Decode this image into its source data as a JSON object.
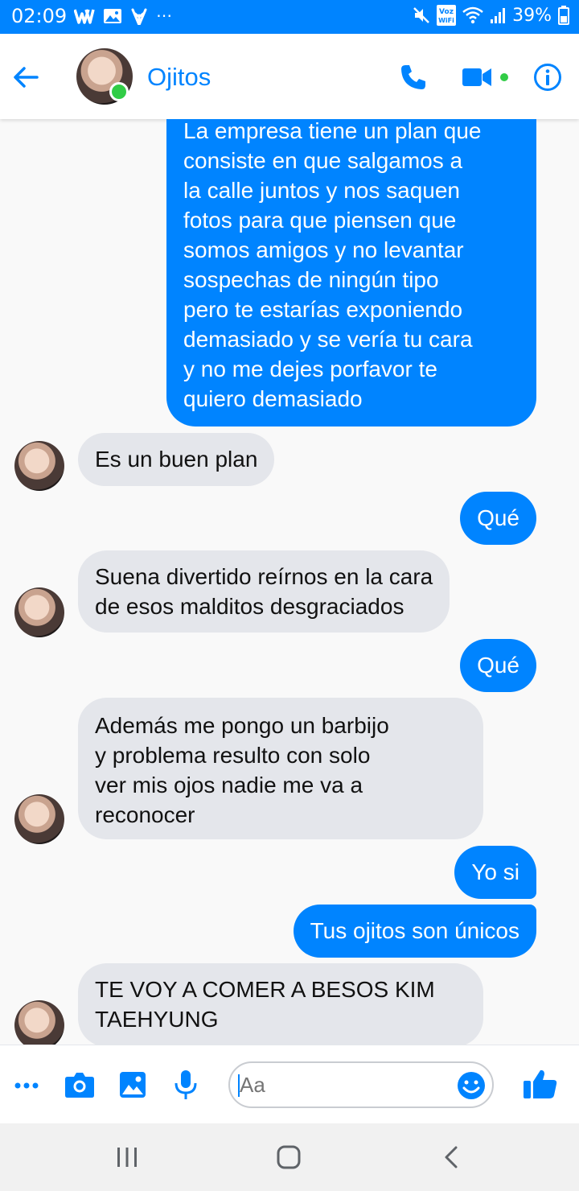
{
  "status_bar": {
    "time": "02:09",
    "battery": "39%",
    "left_icons": [
      "w-app-icon",
      "gallery-icon",
      "leaf-icon",
      "more-icon"
    ],
    "right_icons": [
      "mute-icon",
      "volte-wifi-icon",
      "wifi-icon",
      "signal-icon",
      "battery-icon"
    ],
    "volte_label": "Voz WiFi"
  },
  "header": {
    "contact_name": "Ojitos",
    "online": true
  },
  "messages": [
    {
      "from": "me",
      "text": "La empresa tiene un plan que\nconsiste en que salgamos a\nla calle juntos y nos saquen\nfotos para que piensen que\nsomos amigos y no levantar\nsospechas de ningún tipo\npero te estarías exponiendo\ndemasiado y se vería tu cara\ny no me dejes porfavor te\nquiero demasiado"
    },
    {
      "from": "them",
      "text": "Es un buen plan"
    },
    {
      "from": "me",
      "text": "Qué"
    },
    {
      "from": "them",
      "text": "Suena divertido reírnos en la cara\nde esos malditos desgraciados"
    },
    {
      "from": "me",
      "text": "Qué"
    },
    {
      "from": "them",
      "text": "Además me pongo un barbijo\ny problema resulto con solo\nver mis ojos nadie me va a\nreconocer"
    },
    {
      "from": "me",
      "text": "Yo si"
    },
    {
      "from": "me",
      "text": "Tus ojitos son únicos"
    },
    {
      "from": "them",
      "text": "TE VOY A COMER A BESOS KIM\nTAEHYUNG"
    }
  ],
  "composer": {
    "placeholder": "Aa"
  },
  "colors": {
    "accent": "#0084ff",
    "received_bubble": "#e4e6eb",
    "online": "#31cc46"
  }
}
